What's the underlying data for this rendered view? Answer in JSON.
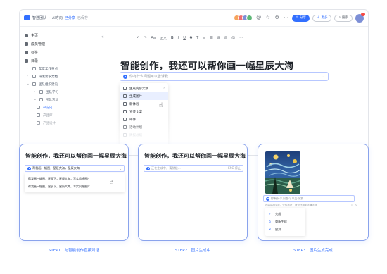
{
  "topbar": {
    "breadcrumb": [
      "智选团队",
      "AI方向"
    ],
    "tag": "已分享",
    "status": "已保存",
    "share_label": "分享",
    "more_label": "更多",
    "search_label": "搜索"
  },
  "sidebar": {
    "items": [
      {
        "label": "主页",
        "icon": "home-icon"
      },
      {
        "label": "成员管理",
        "icon": "people-icon"
      },
      {
        "label": "标签",
        "icon": "tag-icon"
      },
      {
        "label": "目录",
        "icon": "folder-icon"
      }
    ],
    "tree": [
      {
        "label": "年度工作重点",
        "level": 1
      },
      {
        "label": "研发需求文档",
        "level": 1
      },
      {
        "label": "团队组织建设",
        "level": 1
      },
      {
        "label": "团队学习",
        "level": 2
      },
      {
        "label": "团队活动",
        "level": 2
      },
      {
        "label": "AI方向",
        "level": 3,
        "active": true
      },
      {
        "label": "产品库",
        "level": 3
      },
      {
        "label": "产品设计",
        "level": 3
      }
    ]
  },
  "toolbar": {
    "items": [
      "↶",
      "↷",
      "Aa",
      "正文",
      "B",
      "I",
      "U",
      "S",
      "T",
      "≡",
      "☰",
      "⊞",
      "⊟",
      "@",
      "⋯"
    ]
  },
  "editor": {
    "heading": "智能创作，我还可以帮你画一幅星辰大海",
    "prompt_placeholder": "你有什么问题可以告诉我",
    "menu": [
      {
        "label": "生成内容大纲",
        "icon": "outline-icon",
        "arrow": true
      },
      {
        "label": "生成图片",
        "icon": "image-icon",
        "hover": true
      },
      {
        "label": "新体验",
        "icon": "sparkle-icon"
      },
      {
        "label": "宣传文案",
        "icon": "megaphone-icon"
      },
      {
        "label": "邮件",
        "icon": "mail-icon"
      },
      {
        "label": "活动计划",
        "icon": "calendar-icon"
      },
      {
        "label": "周报总结",
        "icon": "report-icon",
        "faded": true
      }
    ]
  },
  "steps": [
    {
      "title": "智能创作，我还可以帮你画一幅星辰大海",
      "prompt_text": "帮我画一幅图，星辰大海，星辰大海",
      "suggestions": [
        "帮我画一幅图，星辰下，星辰大海，写实风格图片",
        "帮我画一幅图，星辰下，星辰大海，写实风格图片"
      ],
      "caption": "STEP1：与智能创作直接对话"
    },
    {
      "title": "智能创作，我还可以帮你画一幅星辰大海",
      "prompt_text": "正在生成中，请稍候...",
      "stop_label": "ESC 停止",
      "caption": "STEP2：图片生成中"
    },
    {
      "prompt_text": "你有什么问题可以告诉我",
      "disclaimer": "内容由AI生成，仅供参考，请遵守相关法律法规",
      "actions": [
        "完成",
        "重新生成",
        "放弃"
      ],
      "caption": "STEP3：图片生成完成"
    }
  ],
  "colors": {
    "accent": "#3370ff",
    "card_border": "#8aa3ec",
    "hover_bg": "#e9efff"
  }
}
